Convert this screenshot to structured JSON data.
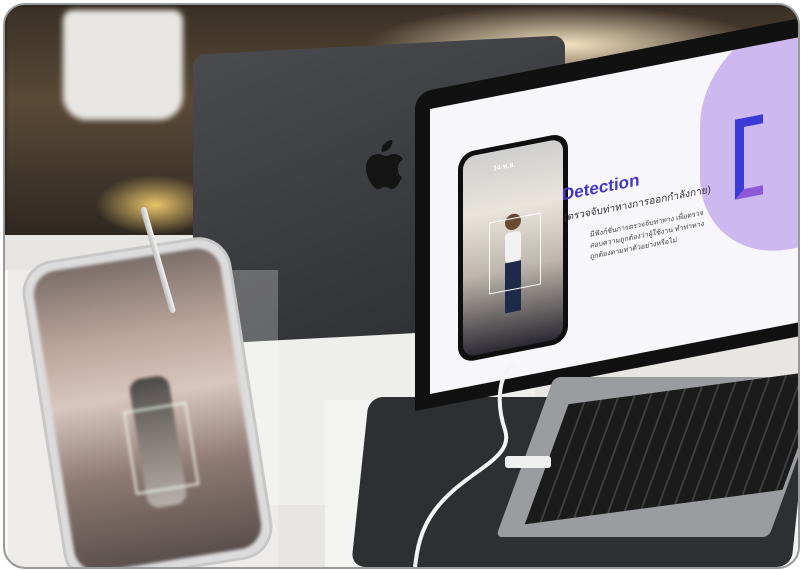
{
  "slide": {
    "title": "Detection",
    "subtitle": "(ตรวจจับท่าทางการออกกำลังกาย)",
    "body": "มีฟังก์ชั่นการตรวจจับท่าทาง เพื่อตรวจสอบความถูกต้องว่าผู้ใช้งาน ทำท่าทางถูกต้องตามท่าตัวอย่างหรือไม่",
    "phone_time": "14 พ.ย."
  },
  "colors": {
    "title": "#4437c6",
    "accent_purple": "#cdb9ef",
    "bracket_blue": "#3a3ad6"
  },
  "objects": {
    "apple_logo": "apple-logo-icon",
    "detect_box": "detection-box"
  }
}
